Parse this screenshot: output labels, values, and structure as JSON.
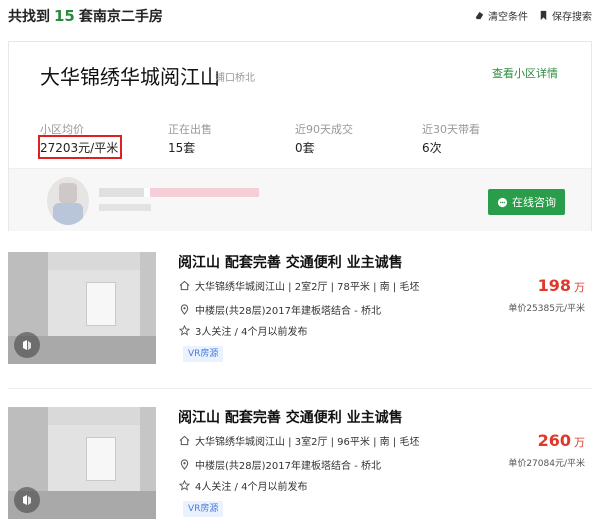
{
  "header": {
    "result_prefix": "共找到",
    "result_count": "15",
    "result_suffix": "套南京二手房",
    "clear_label": "清空条件",
    "save_label": "保存搜索"
  },
  "community": {
    "name": "大华锦绣华城阅江山",
    "region": "浦口桥北",
    "detail_link": "查看小区详情",
    "stats": [
      {
        "label": "小区均价",
        "value": "27203元/平米"
      },
      {
        "label": "正在出售",
        "value": "15套"
      },
      {
        "label": "近90天成交",
        "value": "0套"
      },
      {
        "label": "近30天带看",
        "value": "6次"
      }
    ],
    "consult_label": "在线咨询"
  },
  "listings": [
    {
      "title": "阅江山 配套完善 交通便利 业主诚售",
      "info": "大华锦绣华城阅江山 | 2室2厅 | 78平米 | 南 | 毛坯",
      "floor": "中楼层(共28层)2017年建板塔结合 - 桥北",
      "follow": "3人关注 / 4个月以前发布",
      "tag": "VR房源",
      "total": "198",
      "total_unit": "万",
      "unit_price": "单价25385元/平米"
    },
    {
      "title": "阅江山 配套完善 交通便利 业主诚售",
      "info": "大华锦绣华城阅江山 | 3室2厅 | 96平米 | 南 | 毛坯",
      "floor": "中楼层(共28层)2017年建板塔结合 - 桥北",
      "follow": "4人关注 / 4个月以前发布",
      "tag": "VR房源",
      "total": "260",
      "total_unit": "万",
      "unit_price": "单价27084元/平米"
    }
  ],
  "colors": {
    "accent_green": "#2a8c3b",
    "price_red": "#e0382b",
    "highlight_red": "#e02020",
    "tag_blue": "#4a7cd8"
  },
  "icons": {
    "clear": "eraser-icon",
    "save": "bookmark-icon",
    "consult": "chat-bubble-icon",
    "info": "home-icon",
    "floor": "location-pin-icon",
    "follow": "star-icon",
    "vr": "vr-icon"
  }
}
